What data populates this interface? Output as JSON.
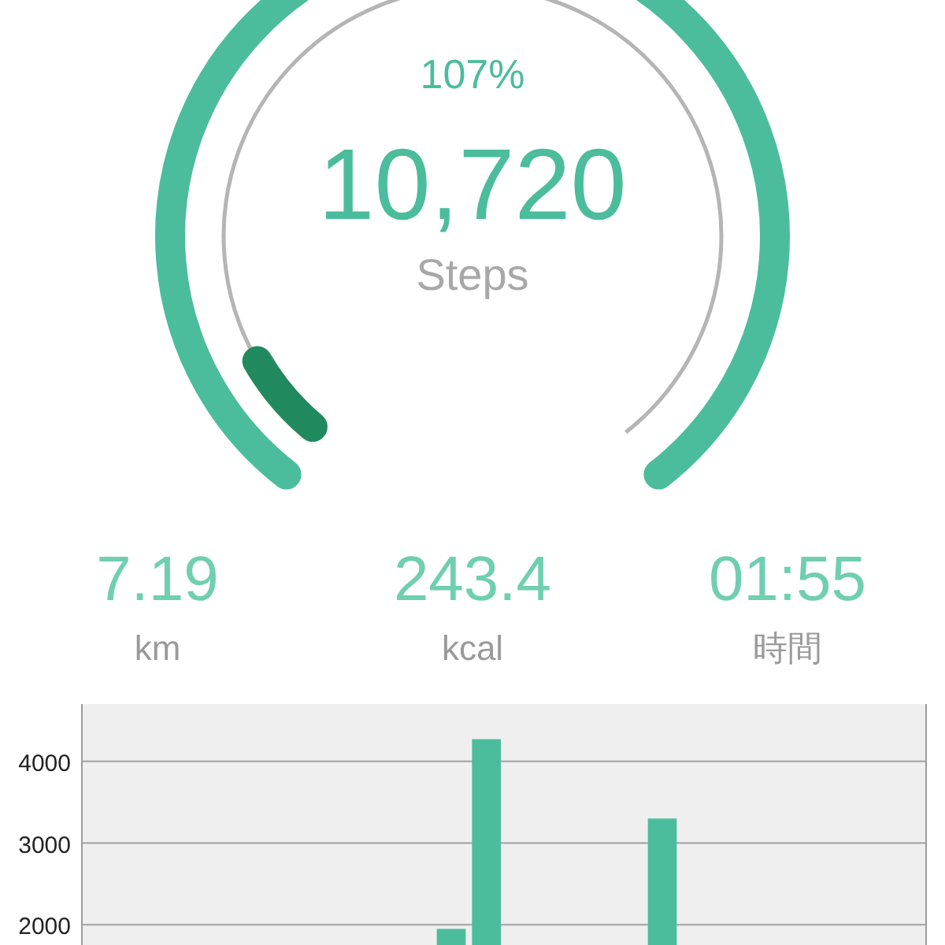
{
  "gauge": {
    "percent": "107%",
    "count": "10,720",
    "unit": "Steps",
    "outer_ring": {
      "level": 1.0
    },
    "inner_ring": {
      "level": 0.07
    }
  },
  "stats": [
    {
      "value": "7.19",
      "label": "km"
    },
    {
      "value": "243.4",
      "label": "kcal"
    },
    {
      "value": "01:55",
      "label": "時間"
    }
  ],
  "chart": {
    "chart_data": {
      "type": "bar",
      "grid": true,
      "ylim": [
        0,
        4700
      ],
      "yticks": [
        2000,
        3000,
        4000
      ],
      "values": [
        null,
        null,
        null,
        null,
        null,
        null,
        null,
        null,
        null,
        null,
        1950,
        4270,
        null,
        null,
        null,
        null,
        3300,
        null,
        null,
        null,
        null,
        null,
        null,
        null
      ]
    }
  }
}
